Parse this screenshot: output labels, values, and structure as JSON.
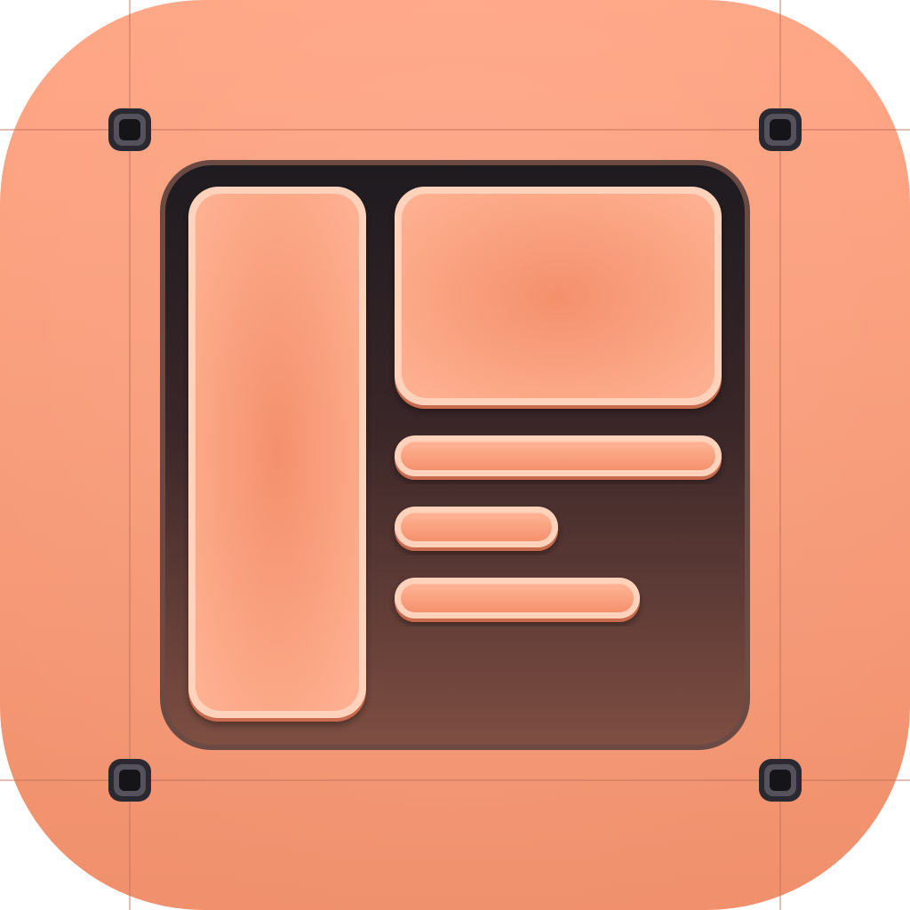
{
  "icon": {
    "semantic": "layout-template-icon",
    "colors": {
      "base_light": "#FFA584",
      "base_dark": "#F0906C",
      "guide_line": "#C07058",
      "screen_top": "#1E1B20",
      "screen_bottom": "#7E4E42",
      "screen_border": "#6A4A42",
      "tile_light": "#FFB596",
      "tile_mid": "#F4906C",
      "tile_edge": "#FFD2BC",
      "tile_shadow": "#C86A4C",
      "screw_body": "#2A2830",
      "screw_highlight": "#55525C",
      "screw_core": "#151419"
    }
  }
}
